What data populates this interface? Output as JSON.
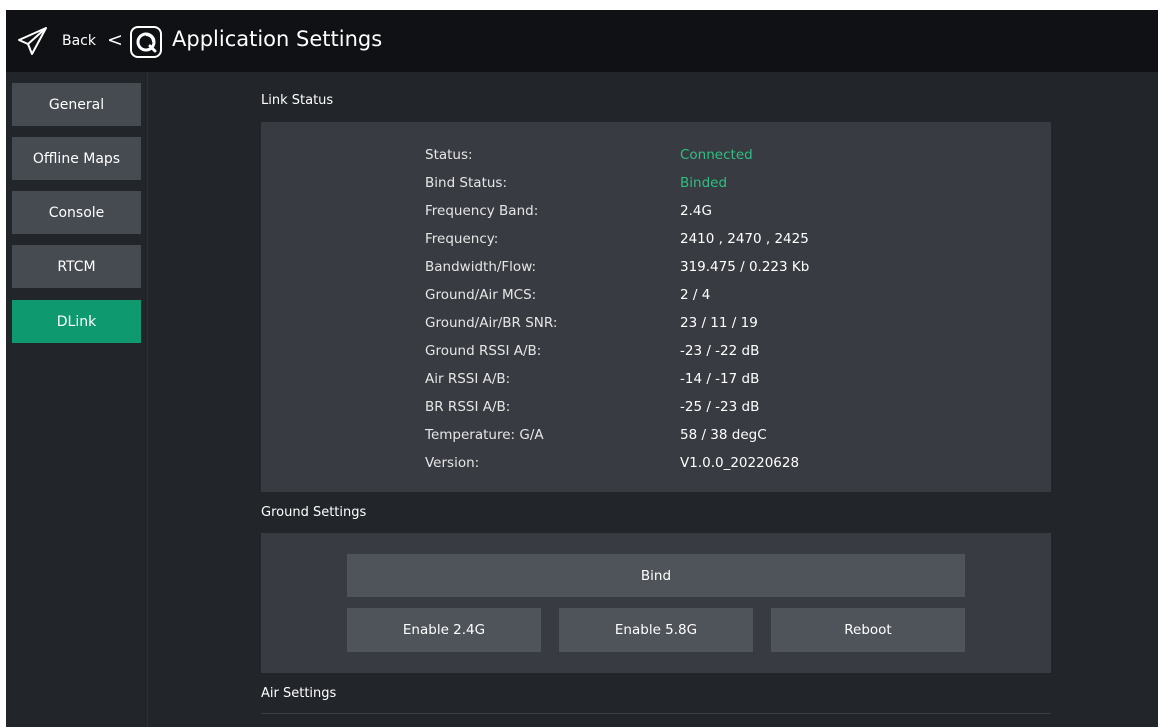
{
  "header": {
    "back_label": "Back",
    "chevron": "<",
    "title": "Application Settings",
    "back_icon": "paper-plane-icon",
    "logo_icon": "app-logo-icon"
  },
  "sidebar": {
    "items": [
      {
        "label": "General",
        "active": false
      },
      {
        "label": "Offline Maps",
        "active": false
      },
      {
        "label": "Console",
        "active": false
      },
      {
        "label": "RTCM",
        "active": false
      },
      {
        "label": "DLink",
        "active": true
      }
    ]
  },
  "colors": {
    "accent": "#0e9a6e",
    "status_ok": "#2fbf84",
    "panel": "#383b41",
    "background": "#22252a",
    "header": "#0f1114"
  },
  "link_status": {
    "section_title": "Link Status",
    "rows": [
      {
        "key": "Status:",
        "value": "Connected"
      },
      {
        "key": "Bind Status:",
        "value": "Binded"
      },
      {
        "key": "Frequency Band:",
        "value": "2.4G"
      },
      {
        "key": "Frequency:",
        "value": "2410 , 2470 , 2425"
      },
      {
        "key": "Bandwidth/Flow:",
        "value": "319.475 / 0.223 Kb"
      },
      {
        "key": "Ground/Air MCS:",
        "value": "2 / 4"
      },
      {
        "key": "Ground/Air/BR SNR:",
        "value": "23 / 11 / 19"
      },
      {
        "key": "Ground RSSI A/B:",
        "value": "-23 / -22 dB"
      },
      {
        "key": "Air RSSI A/B:",
        "value": "-14 / -17 dB"
      },
      {
        "key": "BR RSSI A/B:",
        "value": "-25 / -23 dB"
      },
      {
        "key": "Temperature: G/A",
        "value": "58 / 38 degC"
      },
      {
        "key": "Version:",
        "value": "V1.0.0_20220628"
      }
    ]
  },
  "ground_settings": {
    "section_title": "Ground Settings",
    "bind_label": "Bind",
    "enable_24_label": "Enable 2.4G",
    "enable_58_label": "Enable 5.8G",
    "reboot_label": "Reboot"
  },
  "air_settings": {
    "section_title": "Air Settings"
  }
}
